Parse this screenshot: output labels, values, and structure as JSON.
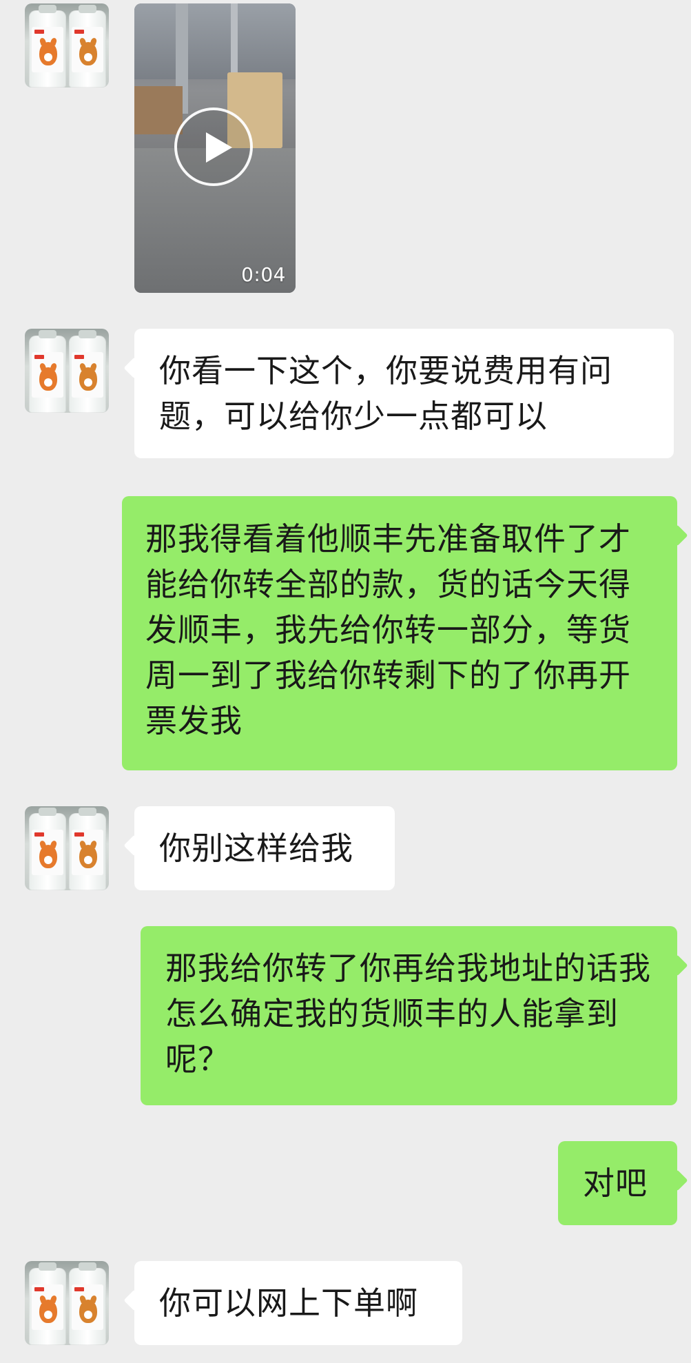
{
  "chat": {
    "video": {
      "duration": "0:04",
      "play_icon": "play-icon"
    },
    "messages": [
      {
        "from": "other",
        "text": "你看一下这个，你要说费用有问题，可以给你少一点都可以"
      },
      {
        "from": "me",
        "text": "那我得看着他顺丰先准备取件了才能给你转全部的款，货的话今天得发顺丰，我先给你转一部分，等货周一到了我给你转剩下的了你再开票发我"
      },
      {
        "from": "other",
        "text": "你别这样给我"
      },
      {
        "from": "me",
        "text": "那我给你转了你再给我地址的话我怎么确定我的货顺丰的人能拿到呢？"
      },
      {
        "from": "me",
        "text": "对吧"
      },
      {
        "from": "other",
        "text": "你可以网上下单啊"
      }
    ]
  },
  "colors": {
    "background": "#ededed",
    "incoming_bubble": "#ffffff",
    "outgoing_bubble": "#95ec69",
    "text": "#191919"
  },
  "icons": {
    "avatar": "avatar-bottles-fox-tiger"
  }
}
